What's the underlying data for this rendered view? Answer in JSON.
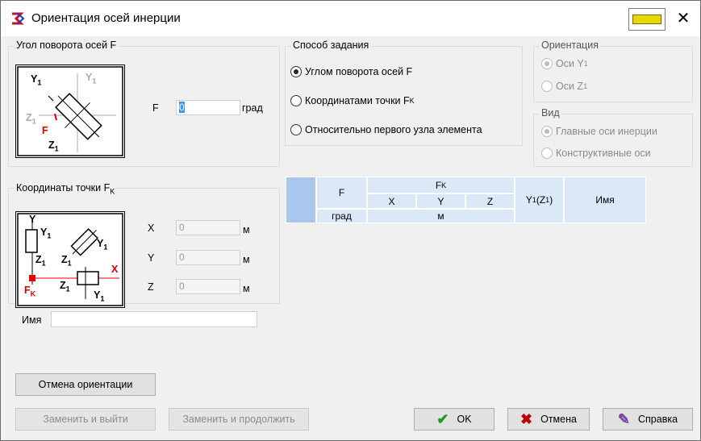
{
  "window": {
    "title": "Ориентация осей инерции",
    "close_glyph": "✕"
  },
  "angle_group": {
    "title": "Угол поворота осей F",
    "label_f": "F",
    "value": "0",
    "unit": "град",
    "diagram": {
      "y1": "Y",
      "z1": "Z",
      "f": "F",
      "sub": "1"
    }
  },
  "method_group": {
    "title": "Способ задания",
    "options": [
      {
        "label": "Углом поворота осей F",
        "selected": true
      },
      {
        "label": "Координатами точки F",
        "sub": "K",
        "selected": false
      },
      {
        "label": "Относительно первого узла элемента",
        "selected": false
      }
    ]
  },
  "orientation_group": {
    "title": "Ориентация",
    "options": [
      {
        "label": "Оси Y",
        "sub": "1",
        "selected": true
      },
      {
        "label": "Оси Z",
        "sub": "1",
        "selected": false
      }
    ]
  },
  "view_group": {
    "title": "Вид",
    "options": [
      {
        "label": "Главные оси инерции",
        "selected": true
      },
      {
        "label": "Конструктивные оси",
        "selected": false
      }
    ]
  },
  "coords_group": {
    "title": "Координаты точки F",
    "title_sub": "K",
    "fields": [
      {
        "label": "X",
        "value": "0",
        "unit": "м"
      },
      {
        "label": "Y",
        "value": "0",
        "unit": "м"
      },
      {
        "label": "Z",
        "value": "0",
        "unit": "м"
      }
    ],
    "diagram": {
      "y": "Y",
      "y1": "Y",
      "z1": "Z",
      "x": "X",
      "fk": "F",
      "fk_sub": "K"
    }
  },
  "name_field": {
    "label": "Имя",
    "value": ""
  },
  "table": {
    "col_f": "F",
    "col_fk": "F",
    "col_fk_sub": "K",
    "col_x": "X",
    "col_y": "Y",
    "col_z": "Z",
    "col_y1z1": "Y",
    "col_y1z1_mid": "(Z",
    "col_y1z1_end": ")",
    "col_y1z1_sub": "1",
    "col_name": "Имя",
    "unit_deg": "град",
    "unit_m": "м"
  },
  "buttons": {
    "cancel_orientation": "Отмена ориентации",
    "replace_exit": "Заменить и выйти",
    "replace_continue": "Заменить и продолжить",
    "ok": "OK",
    "cancel": "Отмена",
    "help": "Справка"
  },
  "colors": {
    "header_blue": "#dbe8f7",
    "corner_blue": "#a9c7ec",
    "red": "#e00000",
    "ok_green": "#1e9b1e"
  }
}
